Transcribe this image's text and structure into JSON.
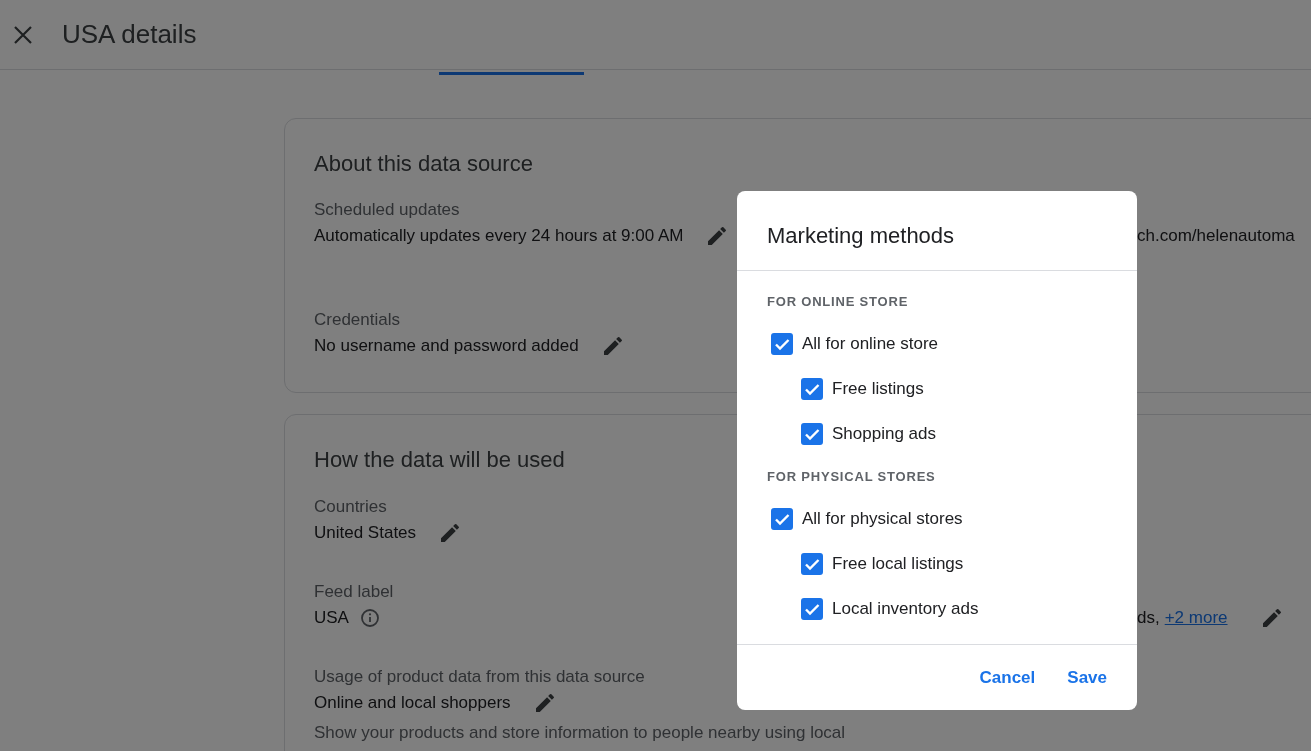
{
  "header": {
    "title": "USA details"
  },
  "cards": [
    {
      "title": "About this data source",
      "rows": [
        {
          "label": "Scheduled updates",
          "value": "Automatically updates every 24 hours at 9:00 AM",
          "editable": true,
          "aside": {
            "text": "ch.com/helenautoma"
          }
        },
        {
          "label": "Credentials",
          "value": "No username and password added",
          "editable": true
        }
      ]
    },
    {
      "title": "How the data will be used",
      "rows": [
        {
          "label": "Countries",
          "value": "United States",
          "editable": true
        },
        {
          "label": "Feed label",
          "value": "USA",
          "info": true,
          "aside": {
            "text": "ds,",
            "link": "+2 more",
            "editable": true
          }
        },
        {
          "label": "Usage of product data from this data source",
          "value": "Online and local shoppers",
          "editable": true,
          "description": "Show your products and store information to people nearby using local"
        }
      ]
    }
  ],
  "dialog": {
    "title": "Marketing methods",
    "sections": [
      {
        "heading": "FOR ONLINE STORE",
        "options": [
          {
            "label": "All for online store",
            "checked": true,
            "children": [
              {
                "label": "Free listings",
                "checked": true
              },
              {
                "label": "Shopping ads",
                "checked": true
              }
            ]
          }
        ]
      },
      {
        "heading": "FOR PHYSICAL STORES",
        "options": [
          {
            "label": "All for physical stores",
            "checked": true,
            "children": [
              {
                "label": "Free local listings",
                "checked": true
              },
              {
                "label": "Local inventory ads",
                "checked": true
              }
            ]
          }
        ]
      }
    ],
    "buttons": [
      "Cancel",
      "Save"
    ]
  }
}
